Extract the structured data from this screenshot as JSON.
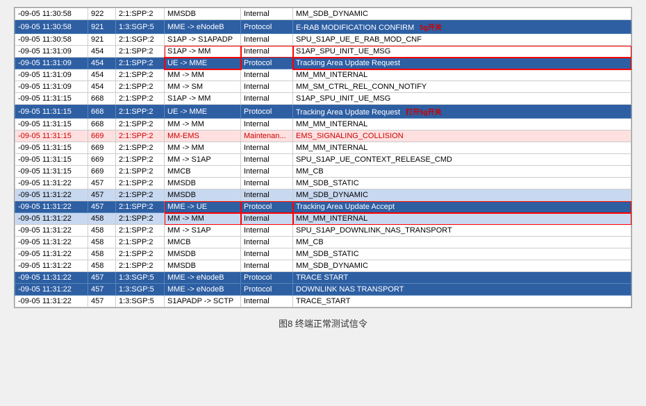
{
  "caption": "图8   终端正常测试信令",
  "rows": [
    {
      "time": "-09-05 11:30:58",
      "id": "922",
      "proc": "2:1:SPP:2",
      "from": "MMSDB",
      "type": "Internal",
      "msg": "MM_SDB_DYNAMIC",
      "style": "normal"
    },
    {
      "time": "-09-05 11:30:58",
      "id": "921",
      "proc": "1:3:SGP:5",
      "from": "MME -> eNodeB",
      "type": "Protocol",
      "msg": "E-RAB MODIFICATION CONFIRM",
      "style": "blue",
      "annotation": "5g开关",
      "annotPos": "right"
    },
    {
      "time": "-09-05 11:30:58",
      "id": "921",
      "proc": "2:1:SGP:2",
      "from": "S1AP -> S1APADP",
      "type": "Internal",
      "msg": "SPU_S1AP_UE_E_RAB_MOD_CNF",
      "style": "normal"
    },
    {
      "time": "-09-05 11:31:09",
      "id": "454",
      "proc": "2:1:SPP:2",
      "from": "S1AP -> MM",
      "type": "Internal",
      "msg": "S1AP_SPU_INIT_UE_MSG",
      "style": "red-outline-row"
    },
    {
      "time": "-09-05 11:31:09",
      "id": "454",
      "proc": "2:1:SPP:2",
      "from": "UE -> MME",
      "type": "Protocol",
      "msg": "Tracking Area Update Request",
      "style": "blue",
      "redOutline": true
    },
    {
      "time": "-09-05 11:31:09",
      "id": "454",
      "proc": "2:1:SPP:2",
      "from": "MM -> MM",
      "type": "Internal",
      "msg": "MM_MM_INTERNAL",
      "style": "normal"
    },
    {
      "time": "-09-05 11:31:09",
      "id": "454",
      "proc": "2:1:SPP:2",
      "from": "MM -> SM",
      "type": "Internal",
      "msg": "MM_SM_CTRL_REL_CONN_NOTIFY",
      "style": "normal"
    },
    {
      "time": "-09-05 11:31:15",
      "id": "668",
      "proc": "2:1:SPP:2",
      "from": "S1AP -> MM",
      "type": "Internal",
      "msg": "S1AP_SPU_INIT_UE_MSG",
      "style": "normal"
    },
    {
      "time": "-09-05 11:31:15",
      "id": "668",
      "proc": "2:1:SPP:2",
      "from": "UE -> MME",
      "type": "Protocol",
      "msg": "Tracking Area Update Request",
      "style": "blue",
      "annotation": "打开5g开关",
      "annotPos": "right"
    },
    {
      "time": "-09-05 11:31:15",
      "id": "668",
      "proc": "2:1:SPP:2",
      "from": "MM -> MM",
      "type": "Internal",
      "msg": "MM_MM_INTERNAL",
      "style": "normal"
    },
    {
      "time": "-09-05 11:31:15",
      "id": "669",
      "proc": "2:1:SPP:2",
      "from": "MM-EMS",
      "type": "Maintenan...",
      "msg": "EMS_SIGNALING_COLLISION",
      "style": "pink"
    },
    {
      "time": "-09-05 11:31:15",
      "id": "669",
      "proc": "2:1:SPP:2",
      "from": "MM -> MM",
      "type": "Internal",
      "msg": "MM_MM_INTERNAL",
      "style": "normal"
    },
    {
      "time": "-09-05 11:31:15",
      "id": "669",
      "proc": "2:1:SPP:2",
      "from": "MM -> S1AP",
      "type": "Internal",
      "msg": "SPU_S1AP_UE_CONTEXT_RELEASE_CMD",
      "style": "normal"
    },
    {
      "time": "-09-05 11:31:15",
      "id": "669",
      "proc": "2:1:SPP:2",
      "from": "MMCB",
      "type": "Internal",
      "msg": "MM_CB",
      "style": "normal"
    },
    {
      "time": "-09-05 11:31:22",
      "id": "457",
      "proc": "2:1:SPP:2",
      "from": "MMSDB",
      "type": "Internal",
      "msg": "MM_SDB_STATIC",
      "style": "normal"
    },
    {
      "time": "-09-05 11:31:22",
      "id": "457",
      "proc": "2:1:SPP:2",
      "from": "MMSDB",
      "type": "Internal",
      "msg": "MM_SDB_DYNAMIC",
      "style": "blue-light"
    },
    {
      "time": "-09-05 11:31:22",
      "id": "457",
      "proc": "2:1:SPP:2",
      "from": "MME -> UE",
      "type": "Protocol",
      "msg": "Tracking Area Update Accept",
      "style": "blue",
      "redOutline": true
    },
    {
      "time": "-09-05 11:31:22",
      "id": "458",
      "proc": "2:1:SPP:2",
      "from": "MM -> MM",
      "type": "Internal",
      "msg": "MM_MM_INTERNAL",
      "style": "blue-light"
    },
    {
      "time": "-09-05 11:31:22",
      "id": "458",
      "proc": "2:1:SPP:2",
      "from": "MM -> S1AP",
      "type": "Internal",
      "msg": "SPU_S1AP_DOWNLINK_NAS_TRANSPORT",
      "style": "normal"
    },
    {
      "time": "-09-05 11:31:22",
      "id": "458",
      "proc": "2:1:SPP:2",
      "from": "MMCB",
      "type": "Internal",
      "msg": "MM_CB",
      "style": "normal"
    },
    {
      "time": "-09-05 11:31:22",
      "id": "458",
      "proc": "2:1:SPP:2",
      "from": "MMSDB",
      "type": "Internal",
      "msg": "MM_SDB_STATIC",
      "style": "normal"
    },
    {
      "time": "-09-05 11:31:22",
      "id": "458",
      "proc": "2:1:SPP:2",
      "from": "MMSDB",
      "type": "Internal",
      "msg": "MM_SDB_DYNAMIC",
      "style": "normal"
    },
    {
      "time": "-09-05 11:31:22",
      "id": "457",
      "proc": "1:3:SGP:5",
      "from": "MME -> eNodeB",
      "type": "Protocol",
      "msg": "TRACE START",
      "style": "blue"
    },
    {
      "time": "-09-05 11:31:22",
      "id": "457",
      "proc": "1:3:SGP:5",
      "from": "MME -> eNodeB",
      "type": "Protocol",
      "msg": "DOWNLINK NAS TRANSPORT",
      "style": "blue"
    },
    {
      "time": "-09-05 11:31:22",
      "id": "457",
      "proc": "1:3:SGP:5",
      "from": "S1APADP -> SCTP",
      "type": "Internal",
      "msg": "TRACE_START",
      "style": "normal"
    }
  ]
}
